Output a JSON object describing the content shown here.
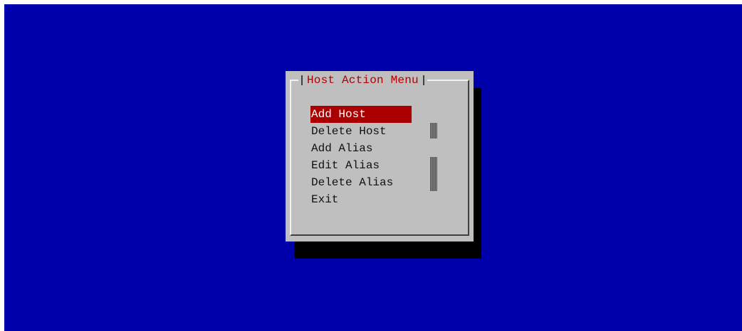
{
  "dialog": {
    "title": "Host Action Menu",
    "items": [
      {
        "label": "Add Host",
        "selected": true
      },
      {
        "label": "Delete Host",
        "selected": false
      },
      {
        "label": "Add Alias",
        "selected": false
      },
      {
        "label": "Edit Alias",
        "selected": false
      },
      {
        "label": "Delete Alias",
        "selected": false
      },
      {
        "label": "Exit",
        "selected": false
      }
    ]
  },
  "colors": {
    "background": "#0000aa",
    "dialog": "#bfbfbf",
    "title_text": "#b00000",
    "selected_item": "#aa0000",
    "shadow": "#000000"
  }
}
